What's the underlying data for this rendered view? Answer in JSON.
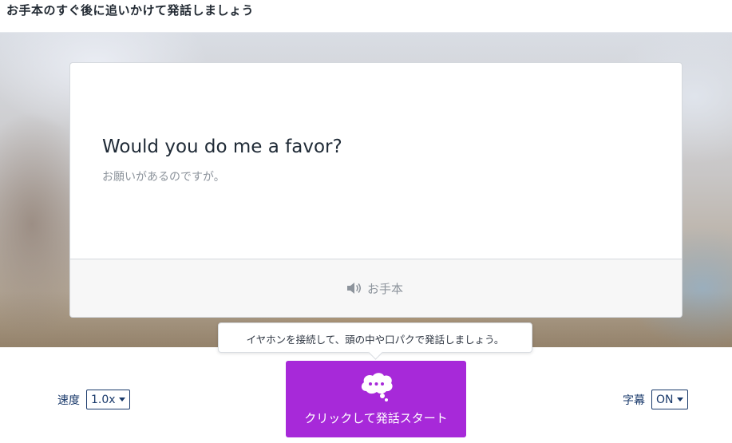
{
  "header": {
    "title": "お手本のすぐ後に追いかけて発話しましょう"
  },
  "card": {
    "sentence_en": "Would you do me a favor?",
    "sentence_ja": "お願いがあるのですが。",
    "model_audio": {
      "icon": "speaker-icon",
      "label": "お手本"
    }
  },
  "tooltip": {
    "text": "イヤホンを接続して、頭の中や口パクで発話しましょう。"
  },
  "controls": {
    "speed": {
      "label": "速度",
      "value": "1.0x"
    },
    "subtitles": {
      "label": "字幕",
      "value": "ON"
    },
    "start_button": {
      "icon": "speech-bubble-icon",
      "label": "クリックして発話スタート"
    }
  },
  "colors": {
    "accent_purple": "#a729d9",
    "control_navy": "#1a3a6b",
    "text_dark": "#1f2a36",
    "text_muted": "#8d949c"
  }
}
